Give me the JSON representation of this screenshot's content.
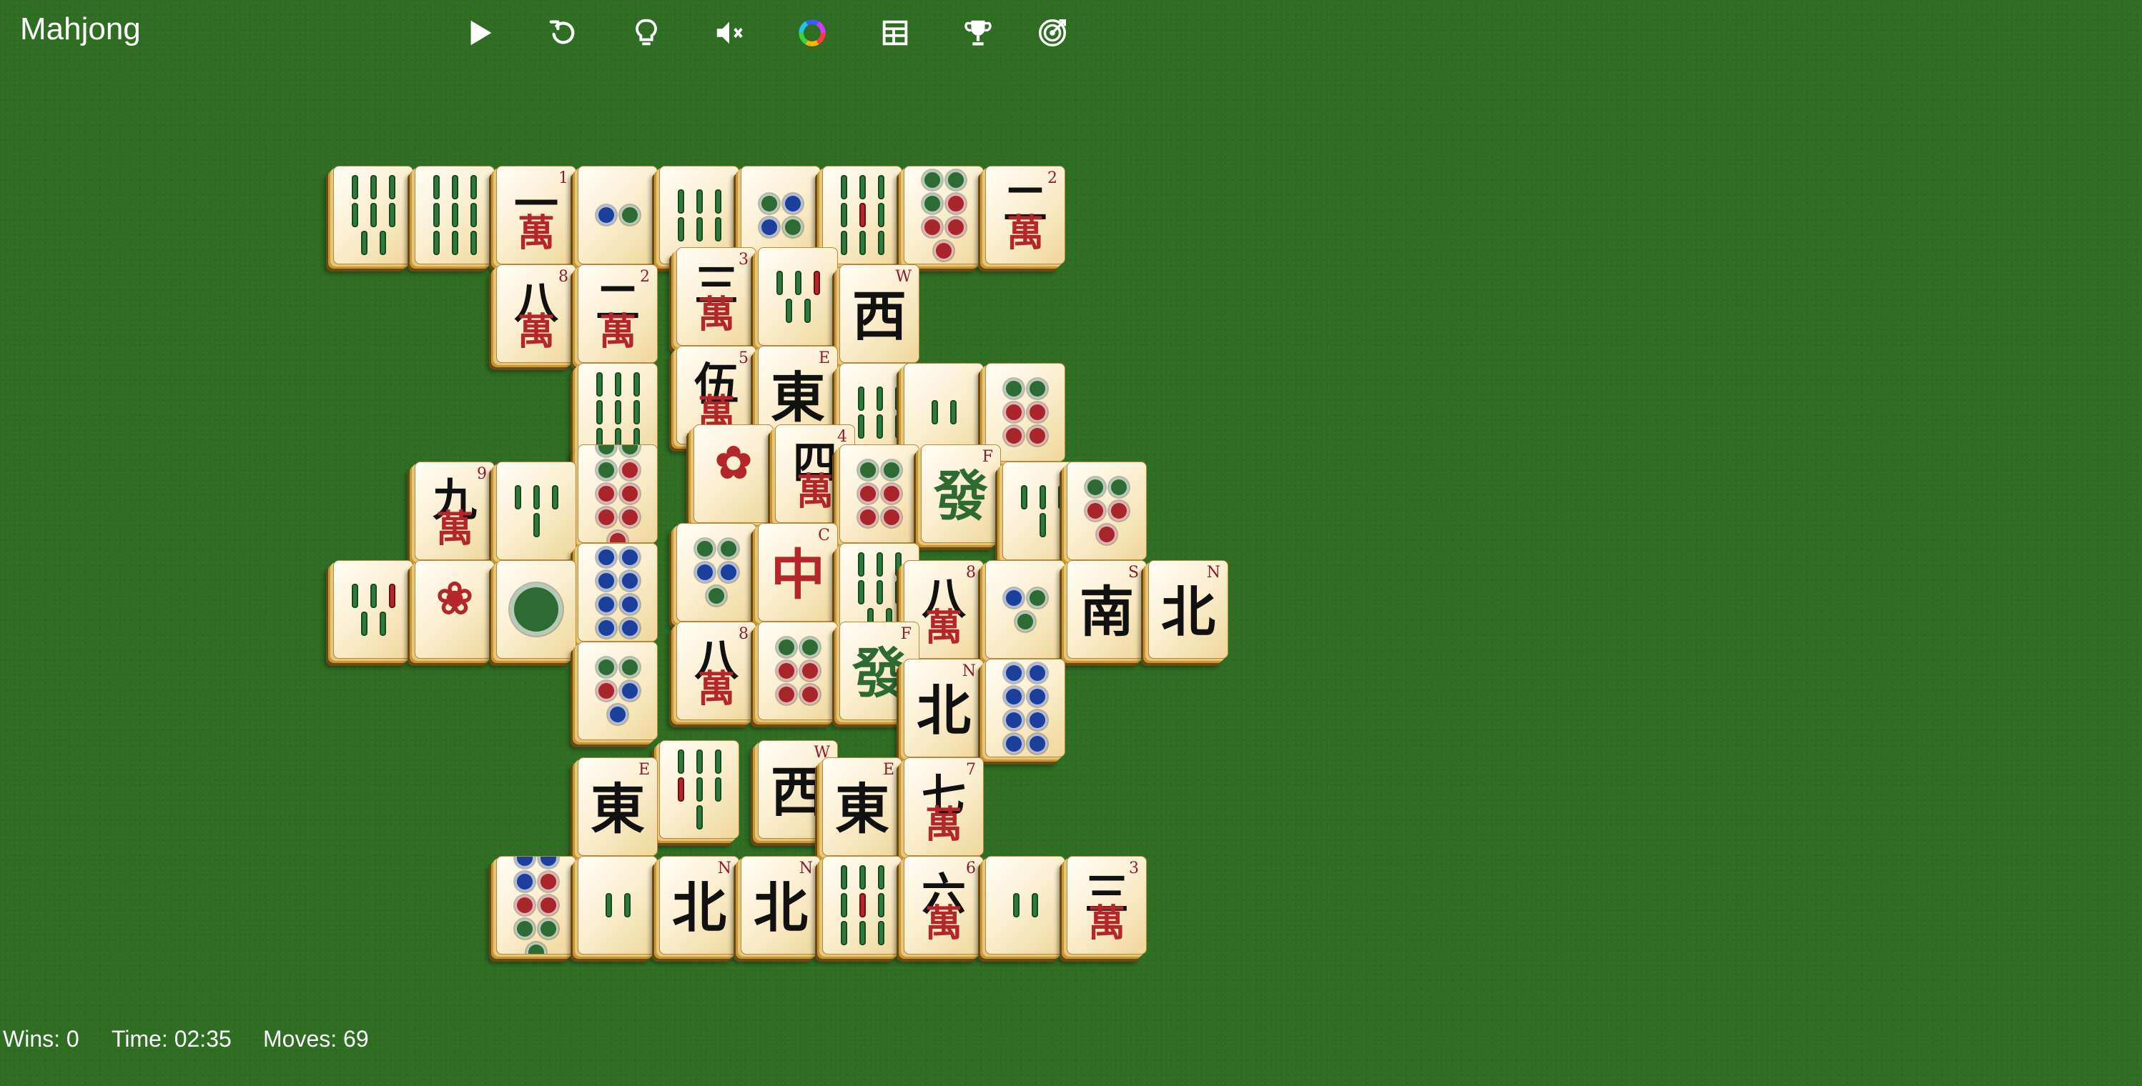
{
  "app": {
    "title": "Mahjong"
  },
  "toolbar": [
    {
      "name": "play-button",
      "icon": "play-icon"
    },
    {
      "name": "undo-button",
      "icon": "undo-icon"
    },
    {
      "name": "hint-button",
      "icon": "lightbulb-icon"
    },
    {
      "name": "sound-button",
      "icon": "mute-icon"
    },
    {
      "name": "theme-button",
      "icon": "color-wheel-icon"
    },
    {
      "name": "layout-button",
      "icon": "layout-icon"
    },
    {
      "name": "trophy-button",
      "icon": "trophy-icon"
    },
    {
      "name": "challenge-button",
      "icon": "target-icon"
    }
  ],
  "colors": {
    "felt": "#2f6d23",
    "tile_face": "#fbf0d3",
    "tile_edge": "#c8962f",
    "red": "#b3262a",
    "blue": "#1b3f9a",
    "green": "#2d6b33"
  },
  "tiles": [
    {
      "kind": "bamboo",
      "n": 8,
      "note": "pattern"
    },
    {
      "kind": "bamboo",
      "n": 9
    },
    {
      "kind": "char",
      "top": "一",
      "bottom": "萬",
      "idx": "1"
    },
    {
      "kind": "dots",
      "n": 2,
      "colors": [
        "blue",
        "green"
      ]
    },
    {
      "kind": "bamboo",
      "n": 6
    },
    {
      "kind": "dots",
      "n": 4,
      "colors": [
        "green",
        "blue",
        "blue",
        "green"
      ]
    },
    {
      "kind": "bamboo",
      "n": 9,
      "red": true
    },
    {
      "kind": "dots",
      "n": 7,
      "colors": [
        "green",
        "green",
        "green",
        "red",
        "red",
        "red",
        "red"
      ]
    },
    {
      "kind": "char",
      "top": "二",
      "bottom": "萬",
      "idx": "2"
    },
    {
      "kind": "char",
      "top": "八",
      "bottom": "萬",
      "idx": "8"
    },
    {
      "kind": "char",
      "top": "二",
      "bottom": "萬",
      "idx": "2"
    },
    {
      "kind": "char",
      "top": "三",
      "bottom": "萬",
      "idx": "3"
    },
    {
      "kind": "bamboo",
      "n": 5,
      "red": true
    },
    {
      "kind": "wind",
      "top": "西",
      "idx": "W"
    },
    {
      "kind": "bamboo",
      "n": 9
    },
    {
      "kind": "char",
      "top": "伍",
      "bottom": "萬",
      "idx": "5"
    },
    {
      "kind": "wind",
      "top": "東",
      "idx": "E"
    },
    {
      "kind": "bamboo",
      "n": 6
    },
    {
      "kind": "bamboo",
      "n": 2
    },
    {
      "kind": "dots",
      "n": 6,
      "colors": [
        "green",
        "green",
        "red",
        "red",
        "red",
        "red"
      ]
    },
    {
      "kind": "char",
      "top": "九",
      "bottom": "萬",
      "idx": "9"
    },
    {
      "kind": "bamboo",
      "n": 4
    },
    {
      "kind": "dots",
      "n": 9,
      "colors": [
        "green",
        "green",
        "green",
        "red",
        "red",
        "red",
        "purple",
        "purple",
        "purple"
      ]
    },
    {
      "kind": "flower",
      "symbol": "✿"
    },
    {
      "kind": "char",
      "top": "四",
      "bottom": "萬",
      "idx": "4"
    },
    {
      "kind": "dots",
      "n": 6,
      "colors": [
        "green",
        "green",
        "red",
        "red",
        "red",
        "red"
      ]
    },
    {
      "kind": "dragon",
      "top": "發",
      "idx": "F"
    },
    {
      "kind": "bamboo",
      "n": 4
    },
    {
      "kind": "dots",
      "n": 5,
      "colors": [
        "green",
        "green",
        "red",
        "red",
        "red"
      ]
    },
    {
      "kind": "bamboo",
      "n": 5,
      "red": true
    },
    {
      "kind": "flower",
      "symbol": "❀"
    },
    {
      "kind": "dots",
      "n": 1,
      "colors": [
        "green"
      ]
    },
    {
      "kind": "dots",
      "n": 8,
      "colors": [
        "blue",
        "blue",
        "blue",
        "blue",
        "blue",
        "blue",
        "blue",
        "blue"
      ]
    },
    {
      "kind": "dots",
      "n": 5,
      "colors": [
        "green",
        "green",
        "blue",
        "blue",
        "green"
      ]
    },
    {
      "kind": "dragon",
      "top": "中",
      "idx": "C"
    },
    {
      "kind": "bamboo",
      "n": 8,
      "note": "pattern"
    },
    {
      "kind": "char",
      "top": "八",
      "bottom": "萬",
      "idx": "8"
    },
    {
      "kind": "dots",
      "n": 3,
      "colors": [
        "blue",
        "green",
        "green"
      ]
    },
    {
      "kind": "wind",
      "top": "南",
      "idx": "S"
    },
    {
      "kind": "wind",
      "top": "北",
      "idx": "N"
    },
    {
      "kind": "dots",
      "n": 5,
      "colors": [
        "green",
        "green",
        "red",
        "blue",
        "blue"
      ]
    },
    {
      "kind": "char",
      "top": "八",
      "bottom": "萬",
      "idx": "8"
    },
    {
      "kind": "dots",
      "n": 6,
      "colors": [
        "green",
        "green",
        "red",
        "red",
        "red",
        "red"
      ]
    },
    {
      "kind": "dragon",
      "top": "發",
      "idx": "F"
    },
    {
      "kind": "wind",
      "top": "北",
      "idx": "N"
    },
    {
      "kind": "dots",
      "n": 8,
      "colors": [
        "blue",
        "blue",
        "blue",
        "blue",
        "blue",
        "blue",
        "blue",
        "blue"
      ]
    },
    {
      "kind": "wind",
      "top": "東",
      "idx": "E"
    },
    {
      "kind": "bamboo",
      "n": 7,
      "red": true
    },
    {
      "kind": "wind",
      "top": "西",
      "idx": "W"
    },
    {
      "kind": "wind",
      "top": "東",
      "idx": "E"
    },
    {
      "kind": "char",
      "top": "七",
      "bottom": "萬",
      "idx": "7"
    },
    {
      "kind": "dots",
      "n": 9,
      "colors": [
        "blue",
        "blue",
        "blue",
        "red",
        "red",
        "red",
        "green",
        "green",
        "green"
      ]
    },
    {
      "kind": "bamboo",
      "n": 2
    },
    {
      "kind": "wind",
      "top": "北",
      "idx": "N"
    },
    {
      "kind": "wind",
      "top": "北",
      "idx": "N"
    },
    {
      "kind": "bamboo",
      "n": 9,
      "red": true
    },
    {
      "kind": "char",
      "top": "六",
      "bottom": "萬",
      "idx": "6"
    },
    {
      "kind": "bamboo",
      "n": 2
    },
    {
      "kind": "char",
      "top": "三",
      "bottom": "萬",
      "idx": "3"
    }
  ],
  "status": {
    "wins": "Wins: 0",
    "time": "Time: 02:35",
    "moves": "Moves: 69"
  }
}
